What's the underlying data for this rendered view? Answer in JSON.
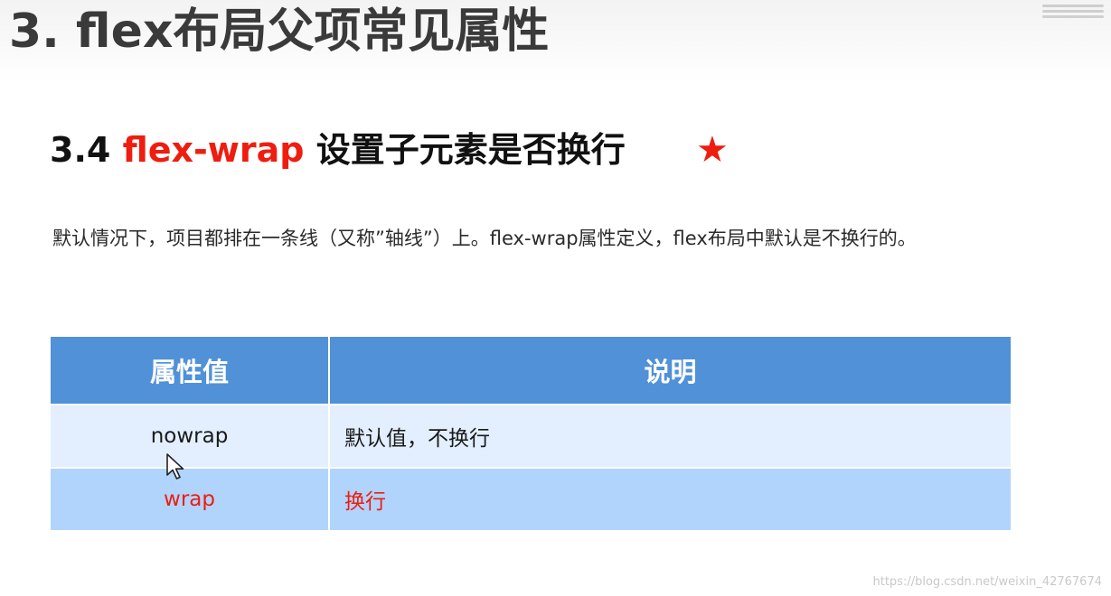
{
  "page_title": "3. flex布局父项常见属性",
  "section": {
    "number": "3.4",
    "property": "flex-wrap",
    "heading_text": "设置子元素是否换行",
    "star_icon": "★"
  },
  "description": "默认情况下，项目都排在一条线（又称”轴线”）上。flex-wrap属性定义，flex布局中默认是不换行的。",
  "table": {
    "headers": [
      "属性值",
      "说明"
    ],
    "rows": [
      {
        "value": "nowrap",
        "desc": "默认值，不换行"
      },
      {
        "value": "wrap",
        "desc": "换行"
      }
    ]
  },
  "watermark": "https://blog.csdn.net/weixin_42767674",
  "colors": {
    "accent_red": "#ee1d10",
    "header_blue": "#5091d8",
    "row_light": "#e3efff",
    "row_strong": "#b1d4fc"
  },
  "icons": {
    "star": "star-icon",
    "cursor": "mouse-cursor-icon"
  }
}
